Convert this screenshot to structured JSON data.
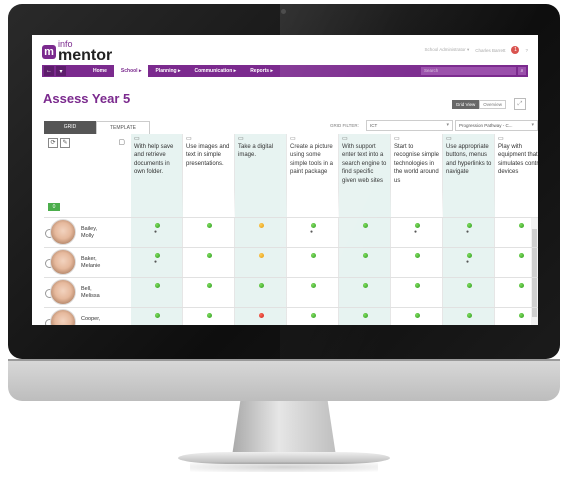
{
  "app": {
    "logo_small": "info",
    "logo_large": "mentor",
    "logo_initial": "m",
    "brand_color": "#7b2a8e",
    "user_bar": [
      "School Administrator ▾",
      "Charles Barrett",
      "1",
      "?"
    ]
  },
  "nav": {
    "back": "←",
    "menu": "▾",
    "items": [
      "Home",
      "School ▸",
      "Planning ▸",
      "Communication ▸",
      "Reports ▸"
    ],
    "active_index": 1,
    "search_placeholder": "Search"
  },
  "page": {
    "title": "Assess Year 5",
    "view_buttons": [
      "Grid View",
      "Overview"
    ],
    "active_view": 0
  },
  "tabs": [
    "GRID",
    "TEMPLATE"
  ],
  "filter": {
    "label": "GRID FILTER:",
    "value": "ICT",
    "pathway": "Progression Pathway - C..."
  },
  "corner": {
    "badge": "0"
  },
  "objectives": [
    {
      "icon": "book-icon",
      "text": "With help save and retrieve documents in own folder."
    },
    {
      "icon": "book-icon",
      "text": "Use images and text in simple presentations."
    },
    {
      "icon": "book-icon",
      "text": "Take a digital image."
    },
    {
      "icon": "book-icon",
      "text": "Create a picture using some simple tools in a paint package"
    },
    {
      "icon": "book-icon",
      "text": "With support enter text into a search engine to find specific given web sites"
    },
    {
      "icon": "book-icon",
      "text": "Start to recognise simple technologies in the world around us"
    },
    {
      "icon": "book-icon",
      "text": "Use appropriate buttons, menus and hyperlinks to navigate"
    },
    {
      "icon": "book-icon",
      "text": "Play with equipment that simulates control devices"
    }
  ],
  "students": [
    {
      "last": "Bailey,",
      "first": "Molly",
      "marks": [
        "green",
        "green",
        "orange",
        "green",
        "green",
        "green",
        "green",
        "green"
      ],
      "comments": [
        true,
        false,
        false,
        true,
        false,
        true,
        true,
        false
      ]
    },
    {
      "last": "Baker,",
      "first": "Melanie",
      "marks": [
        "green",
        "green",
        "orange",
        "green",
        "green",
        "green",
        "green",
        "green"
      ],
      "comments": [
        true,
        false,
        false,
        false,
        false,
        false,
        true,
        false
      ]
    },
    {
      "last": "Bell,",
      "first": "Melissa",
      "marks": [
        "green",
        "green",
        "green",
        "green",
        "green",
        "green",
        "green",
        "green"
      ],
      "comments": [
        false,
        false,
        false,
        false,
        false,
        false,
        false,
        false
      ]
    },
    {
      "last": "Cooper,",
      "first": "",
      "marks": [
        "green",
        "green",
        "red",
        "green",
        "green",
        "green",
        "green",
        "green"
      ],
      "comments": [
        false,
        false,
        false,
        false,
        false,
        false,
        false,
        false
      ]
    }
  ]
}
